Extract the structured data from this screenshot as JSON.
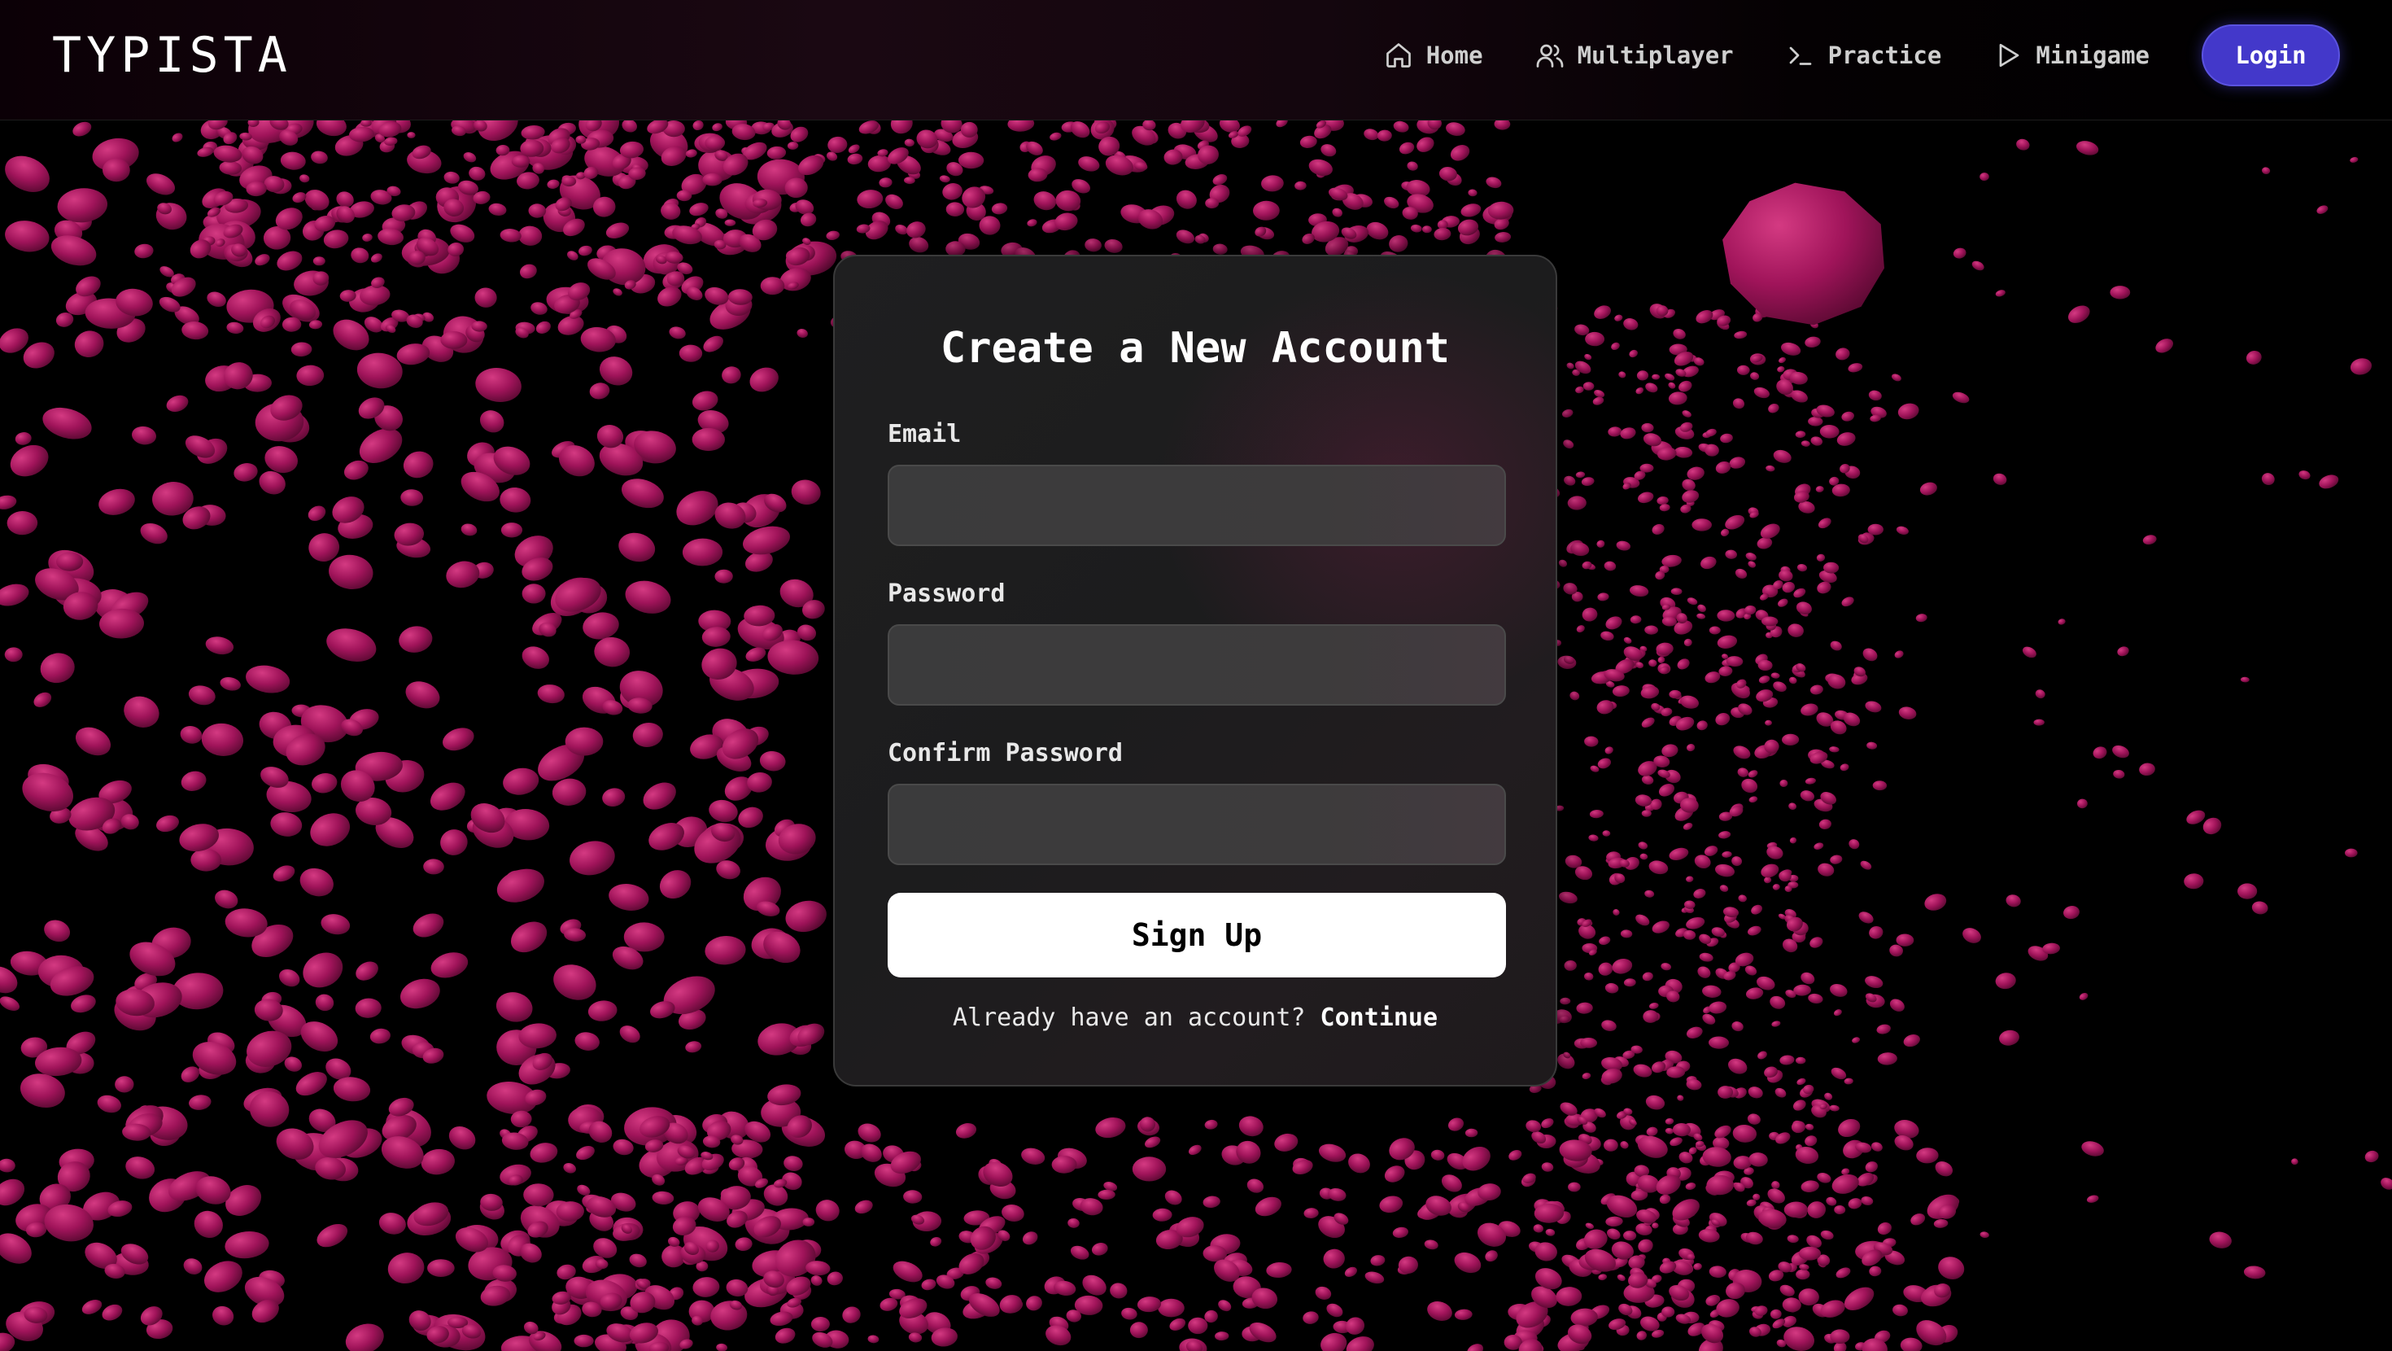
{
  "header": {
    "logo": "TYPISTA",
    "nav": [
      {
        "label": "Home",
        "icon": "home-icon"
      },
      {
        "label": "Multiplayer",
        "icon": "users-icon"
      },
      {
        "label": "Practice",
        "icon": "terminal-icon"
      },
      {
        "label": "Minigame",
        "icon": "play-icon"
      }
    ],
    "login_label": "Login"
  },
  "form": {
    "title": "Create a New Account",
    "fields": [
      {
        "label": "Email",
        "value": "",
        "placeholder": ""
      },
      {
        "label": "Password",
        "value": "",
        "placeholder": ""
      },
      {
        "label": "Confirm Password",
        "value": "",
        "placeholder": ""
      }
    ],
    "submit_label": "Sign Up",
    "footer_prompt": "Already have an account?",
    "footer_link": "Continue"
  },
  "colors": {
    "background": "#000000",
    "particle": "#a0145a",
    "accent": "#4338ca",
    "card": "#1e1e1f"
  }
}
